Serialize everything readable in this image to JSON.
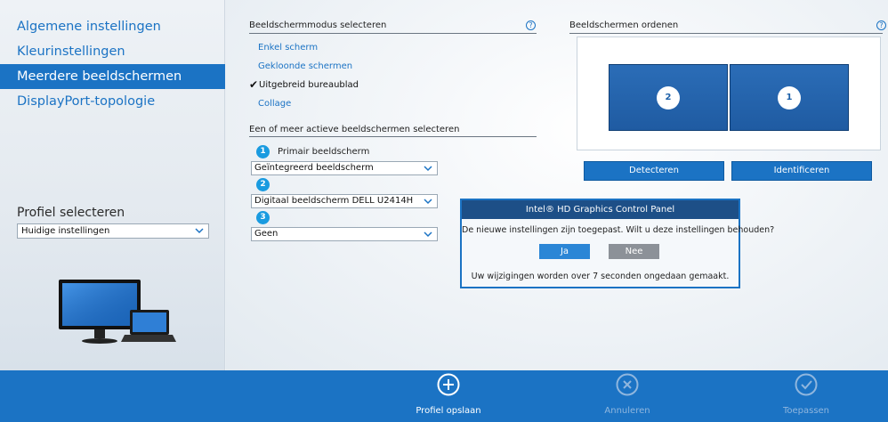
{
  "sidebar": {
    "items": [
      {
        "label": "Algemene instellingen",
        "active": false
      },
      {
        "label": "Kleurinstellingen",
        "active": false
      },
      {
        "label": "Meerdere beeldschermen",
        "active": true
      },
      {
        "label": "DisplayPort-topologie",
        "active": false
      }
    ],
    "profile_label": "Profiel selecteren",
    "profile_value": "Huidige instellingen"
  },
  "mode": {
    "title": "Beeldschermmodus selecteren",
    "help": "?",
    "options": [
      {
        "label": "Enkel scherm",
        "selected": false
      },
      {
        "label": "Gekloonde schermen",
        "selected": false
      },
      {
        "label": "Uitgebreid bureaublad",
        "selected": true
      },
      {
        "label": "Collage",
        "selected": false
      }
    ],
    "check_glyph": "✔"
  },
  "active": {
    "title": "Een of meer actieve beeldschermen selecteren",
    "badges": [
      "1",
      "2",
      "3"
    ],
    "primary_label": "Primair beeldscherm",
    "selects": [
      "Geïntegreerd beeldscherm",
      "Digitaal beeldscherm DELL U2414H",
      "Geen"
    ]
  },
  "arrange": {
    "title": "Beeldschermen ordenen",
    "help": "?",
    "screens": [
      "2",
      "1"
    ],
    "detect_label": "Detecteren",
    "identify_label": "Identificeren"
  },
  "dialog": {
    "title": "Intel® HD Graphics Control Panel",
    "message": "De nieuwe instellingen zijn toegepast. Wilt u deze instellingen behouden?",
    "yes_label": "Ja",
    "no_label": "Nee",
    "footer": "Uw wijzigingen worden over 7 seconden ongedaan gemaakt."
  },
  "bottombar": {
    "save_label": "Profiel opslaan",
    "cancel_label": "Annuleren",
    "apply_label": "Toepassen",
    "save_icon": "plus-circle-icon",
    "cancel_icon": "x-circle-icon",
    "apply_icon": "check-circle-icon"
  },
  "colors": {
    "accent": "#1b73c4",
    "dialog_title_bg": "#1d4f87",
    "badge": "#1a9be0",
    "tile": "#1f5ba2"
  }
}
